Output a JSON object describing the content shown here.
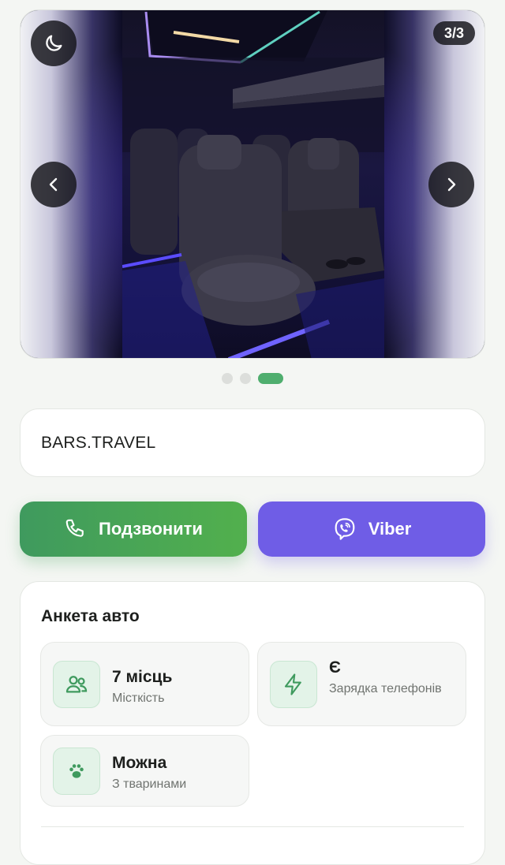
{
  "gallery": {
    "counter": "3/3",
    "dots": [
      false,
      false,
      true
    ]
  },
  "carrier": {
    "name": "BARS.TRAVEL"
  },
  "actions": {
    "call_label": "Подзвонити",
    "viber_label": "Viber"
  },
  "specs": {
    "title": "Анкета авто",
    "items": [
      {
        "value": "7 місць",
        "label": "Місткість",
        "icon": "users-icon"
      },
      {
        "value": "Є",
        "label": "Зарядка телефонів",
        "icon": "lightning-icon"
      },
      {
        "value": "Можна",
        "label": "З тваринами",
        "icon": "paw-icon"
      }
    ]
  },
  "colors": {
    "accent_green": "#4fae6e",
    "viber_purple": "#6f5de6",
    "background": "#f4f6f3"
  }
}
